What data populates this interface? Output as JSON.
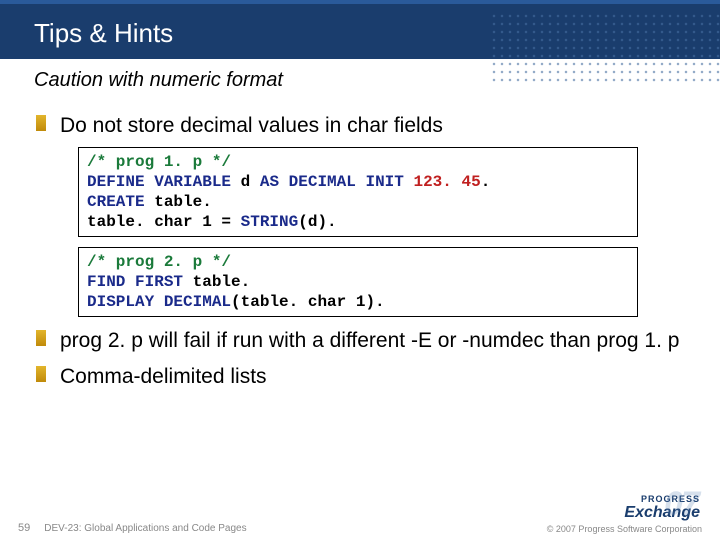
{
  "header": {
    "title": "Tips & Hints"
  },
  "subtitle": "Caution with numeric format",
  "bullets": {
    "b1": "Do not store decimal values in char fields",
    "b2": "prog 2. p will fail if run with a different -E or -numdec than prog 1. p",
    "b3": "Comma-delimited lists"
  },
  "code1": {
    "c1a": "/* prog 1. p */",
    "c1b_a": "DEFINE VARIABLE",
    "c1b_b": " d ",
    "c1b_c": "AS DECIMAL INIT",
    "c1b_d": " 123. 45",
    "c1b_e": ".",
    "c1c_a": "CREATE",
    "c1c_b": " table.",
    "c1d_a": "table. char 1 = ",
    "c1d_b": "STRING",
    "c1d_c": "(d)."
  },
  "code2": {
    "c2a": "/* prog 2. p */",
    "c2b_a": "FIND FIRST",
    "c2b_b": " table.",
    "c2c_a": "DISPLAY DECIMAL",
    "c2c_b": "(table. char 1)."
  },
  "footer": {
    "slidenum": "59",
    "session": "DEV-23: Global Applications and Code Pages",
    "progress": "PROGRESS",
    "exchange": "Exchange",
    "year": "07",
    "copyright": "© 2007 Progress Software Corporation"
  }
}
